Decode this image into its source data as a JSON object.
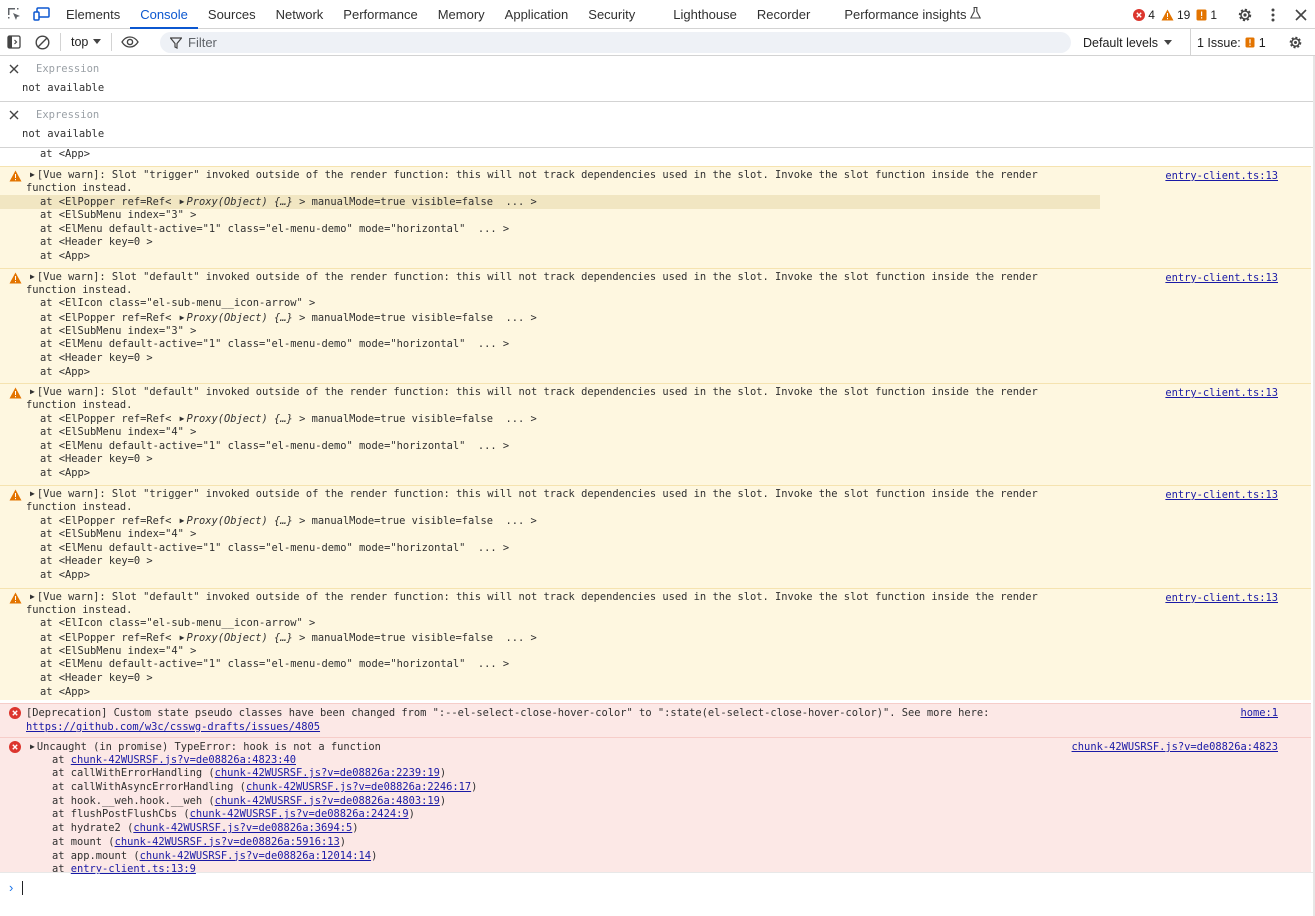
{
  "tabbar": {
    "tabs": [
      "Elements",
      "Console",
      "Sources",
      "Network",
      "Performance",
      "Memory",
      "Application",
      "Security",
      "Lighthouse",
      "Recorder",
      "Performance insights"
    ],
    "active": "Console",
    "error_count": "4",
    "warning_count": "19",
    "issue_count": "1",
    "icons": [
      "inspect-element-icon",
      "device-toolbar-icon",
      "beaker-icon",
      "settings-icon",
      "more-vert-icon",
      "close-icon"
    ]
  },
  "toolbar": {
    "context": "top",
    "filter_placeholder": "Filter",
    "levels": "Default levels",
    "issues_label": "1 Issue:",
    "issues_count": "1",
    "icons": [
      "sidebar-icon",
      "clear-console-icon",
      "eye-icon",
      "filter-icon",
      "settings-icon"
    ]
  },
  "live_expressions": [
    {
      "label": "Expression",
      "value": "not available"
    },
    {
      "label": "Expression",
      "value": "not available"
    }
  ],
  "console": {
    "top_fragment": "at <App>",
    "messages": [
      {
        "level": "warning",
        "text": "[Vue warn]: Slot \"trigger\" invoked outside of the render function: this will not track dependencies used in the slot. Invoke the slot function inside the render",
        "text2": "function instead.",
        "source": "entry-client.ts:13",
        "stack": [
          "at <ElPopper ref=Ref< ",
          "at <ElSubMenu index=\"3\" >",
          "at <ElMenu default-active=\"1\" class=\"el-menu-demo\" mode=\"horizontal\"  ... >",
          "at <Header key=0 >",
          "at <App>"
        ]
      },
      {
        "level": "warning",
        "text": "[Vue warn]: Slot \"default\" invoked outside of the render function: this will not track dependencies used in the slot. Invoke the slot function inside the render",
        "text2": "function instead.",
        "source": "entry-client.ts:13",
        "stack": [
          "at <ElIcon class=\"el-sub-menu__icon-arrow\" >",
          "at <ElPopper ref=Ref< ",
          "at <ElSubMenu index=\"3\" >",
          "at <ElMenu default-active=\"1\" class=\"el-menu-demo\" mode=\"horizontal\"  ... >",
          "at <Header key=0 >",
          "at <App>"
        ]
      },
      {
        "level": "warning",
        "text": "[Vue warn]: Slot \"default\" invoked outside of the render function: this will not track dependencies used in the slot. Invoke the slot function inside the render",
        "text2": "function instead.",
        "source": "entry-client.ts:13",
        "stack": [
          "at <ElPopper ref=Ref< ",
          "at <ElSubMenu index=\"4\" >",
          "at <ElMenu default-active=\"1\" class=\"el-menu-demo\" mode=\"horizontal\"  ... >",
          "at <Header key=0 >",
          "at <App>"
        ]
      },
      {
        "level": "warning",
        "text": "[Vue warn]: Slot \"trigger\" invoked outside of the render function: this will not track dependencies used in the slot. Invoke the slot function inside the render",
        "text2": "function instead.",
        "source": "entry-client.ts:13",
        "stack": [
          "at <ElPopper ref=Ref< ",
          "at <ElSubMenu index=\"4\" >",
          "at <ElMenu default-active=\"1\" class=\"el-menu-demo\" mode=\"horizontal\"  ... >",
          "at <Header key=0 >",
          "at <App>"
        ]
      },
      {
        "level": "warning",
        "text": "[Vue warn]: Slot \"default\" invoked outside of the render function: this will not track dependencies used in the slot. Invoke the slot function inside the render",
        "text2": "function instead.",
        "source": "entry-client.ts:13",
        "stack": [
          "at <ElIcon class=\"el-sub-menu__icon-arrow\" >",
          "at <ElPopper ref=Ref< ",
          "at <ElSubMenu index=\"4\" >",
          "at <ElMenu default-active=\"1\" class=\"el-menu-demo\" mode=\"horizontal\"  ... >",
          "at <Header key=0 >",
          "at <App>"
        ]
      }
    ],
    "popper_suffix": "Proxy(Object) {…}",
    "popper_tail": " > manualMode=true visible=false  ... >",
    "deprecation": {
      "text": "[Deprecation] Custom state pseudo classes have been changed from \":--el-select-close-hover-color\" to \":state(el-select-close-hover-color)\". See more here:",
      "link": "https://github.com/w3c/csswg-drafts/issues/4805",
      "source": "home:1"
    },
    "uncaught": {
      "text": "Uncaught (in promise) TypeError: hook is not a function",
      "source": "chunk-42WUSRSF.js?v=de08826a:4823",
      "stack": [
        {
          "prefix": "at ",
          "link": "chunk-42WUSRSF.js?v=de08826a:4823:40",
          "suffix": ""
        },
        {
          "prefix": "at callWithErrorHandling (",
          "link": "chunk-42WUSRSF.js?v=de08826a:2239:19",
          "suffix": ")"
        },
        {
          "prefix": "at callWithAsyncErrorHandling (",
          "link": "chunk-42WUSRSF.js?v=de08826a:2246:17",
          "suffix": ")"
        },
        {
          "prefix": "at hook.__weh.hook.__weh (",
          "link": "chunk-42WUSRSF.js?v=de08826a:4803:19",
          "suffix": ")"
        },
        {
          "prefix": "at flushPostFlushCbs (",
          "link": "chunk-42WUSRSF.js?v=de08826a:2424:9",
          "suffix": ")"
        },
        {
          "prefix": "at hydrate2 (",
          "link": "chunk-42WUSRSF.js?v=de08826a:3694:5",
          "suffix": ")"
        },
        {
          "prefix": "at mount (",
          "link": "chunk-42WUSRSF.js?v=de08826a:5916:13",
          "suffix": ")"
        },
        {
          "prefix": "at app.mount (",
          "link": "chunk-42WUSRSF.js?v=de08826a:12014:14",
          "suffix": ")"
        },
        {
          "prefix": "at ",
          "link": "entry-client.ts:13:9",
          "suffix": ""
        }
      ]
    }
  },
  "colors": {
    "accent": "#0b57d0",
    "warning_bg": "#fef7e0",
    "error_bg": "#fce8e6",
    "link": "#1a1aa6",
    "error_red": "#dc362e",
    "warning_orange": "#e37400"
  }
}
